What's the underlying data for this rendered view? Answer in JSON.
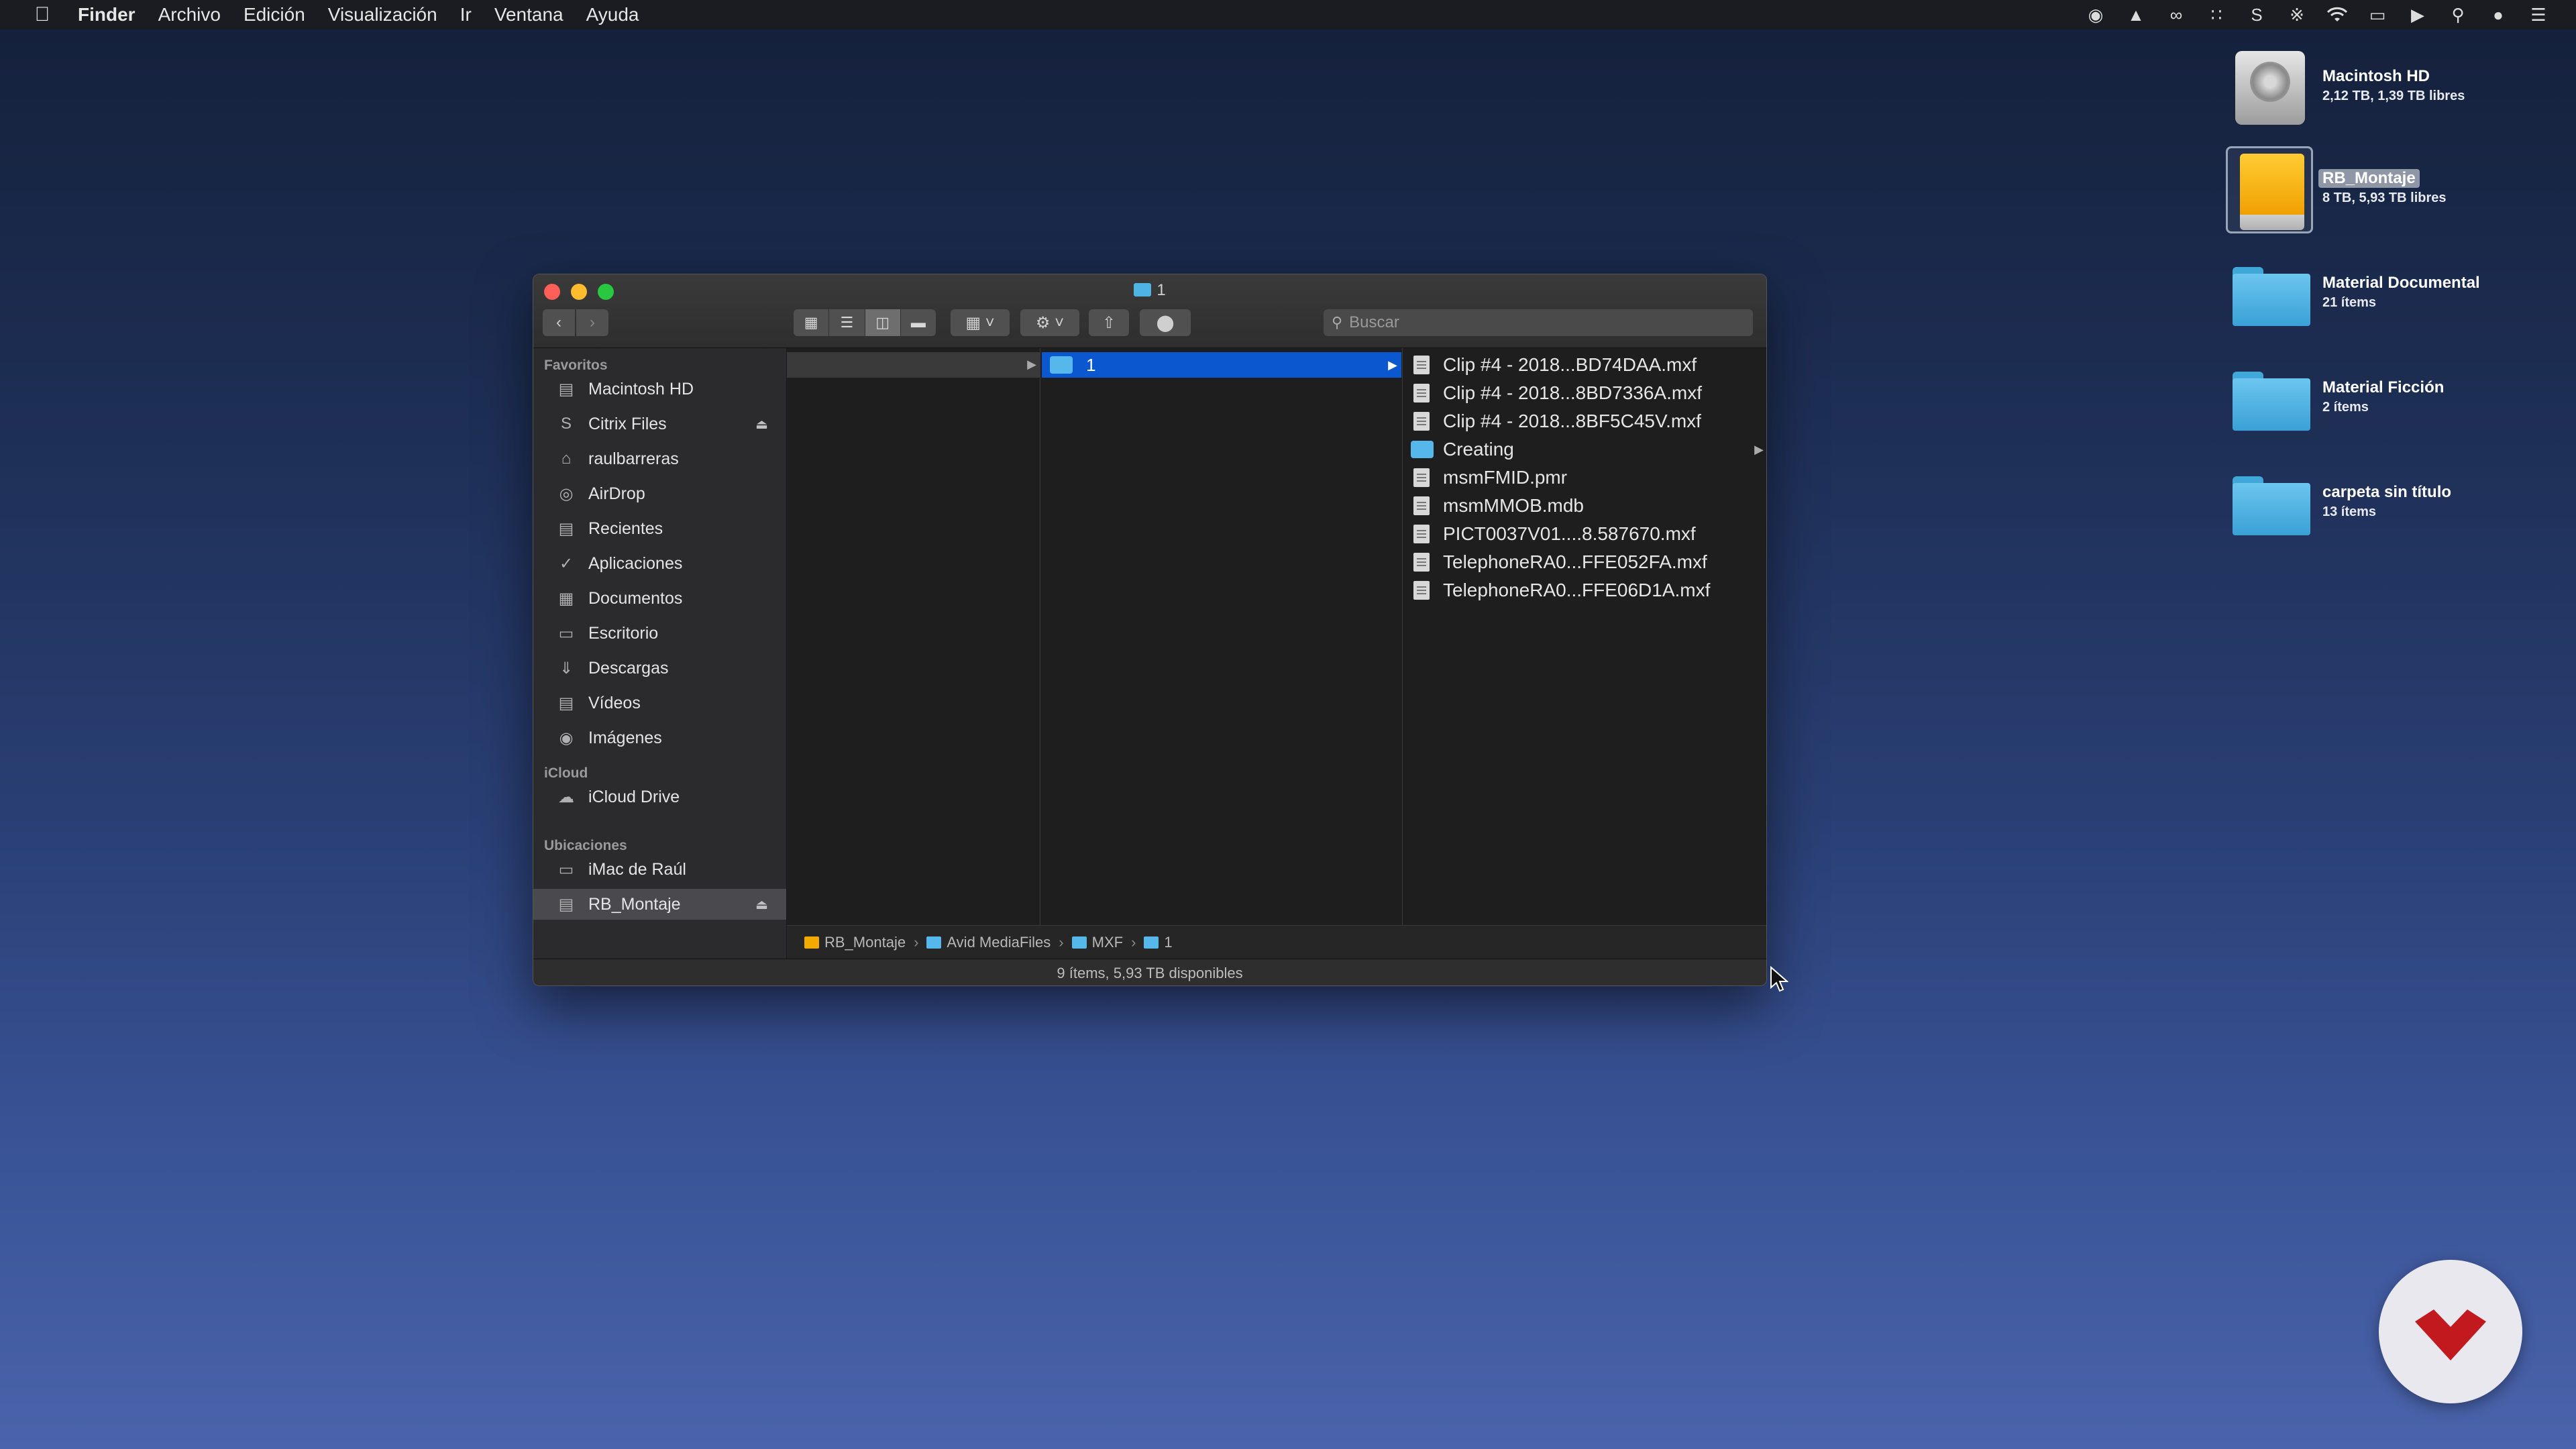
{
  "menubar": {
    "apple_icon": "apple-icon",
    "items": [
      "Finder",
      "Archivo",
      "Edición",
      "Visualización",
      "Ir",
      "Ventana",
      "Ayuda"
    ],
    "status_icons": [
      "record-icon",
      "upload-icon",
      "creative-cloud-icon",
      "grid-icon",
      "citrix-icon",
      "bluetooth-icon",
      "wifi-icon",
      "airplay-icon",
      "volume-icon",
      "spotlight-icon",
      "siri-icon",
      "notification-center-icon"
    ]
  },
  "desktop": {
    "items": [
      {
        "name": "Macintosh HD",
        "sub": "2,12 TB, 1,39 TB libres",
        "kind": "hd"
      },
      {
        "name": "RB_Montaje",
        "sub": "8 TB, 5,93 TB libres",
        "kind": "drive",
        "selected": true
      },
      {
        "name": "Material Documental",
        "sub": "21 ítems",
        "kind": "folder"
      },
      {
        "name": "Material Ficción",
        "sub": "2 ítems",
        "kind": "folder"
      },
      {
        "name": "carpeta sin título",
        "sub": "13 ítems",
        "kind": "folder"
      }
    ]
  },
  "window": {
    "title": "1",
    "search_placeholder": "Buscar",
    "sidebar": {
      "favoritos_header": "Favoritos",
      "favoritos": [
        {
          "label": "Macintosh HD",
          "icon": "hard-drive-icon"
        },
        {
          "label": "Citrix Files",
          "icon": "citrix-icon",
          "eject": true
        },
        {
          "label": "raulbarreras",
          "icon": "home-icon"
        },
        {
          "label": "AirDrop",
          "icon": "airdrop-icon"
        },
        {
          "label": "Recientes",
          "icon": "recents-icon"
        },
        {
          "label": "Aplicaciones",
          "icon": "applications-icon"
        },
        {
          "label": "Documentos",
          "icon": "documents-icon"
        },
        {
          "label": "Escritorio",
          "icon": "desktop-icon"
        },
        {
          "label": "Descargas",
          "icon": "downloads-icon"
        },
        {
          "label": "Vídeos",
          "icon": "movies-icon"
        },
        {
          "label": "Imágenes",
          "icon": "pictures-icon"
        }
      ],
      "icloud_header": "iCloud",
      "icloud": [
        {
          "label": "iCloud Drive",
          "icon": "cloud-icon"
        }
      ],
      "ubicaciones_header": "Ubicaciones",
      "ubicaciones": [
        {
          "label": "iMac de Raúl",
          "icon": "computer-icon"
        },
        {
          "label": "RB_Montaje",
          "icon": "external-drive-icon",
          "eject": true,
          "selected": true
        }
      ]
    },
    "column2_selected": "1",
    "files": [
      {
        "name": "Clip #4 - 2018...BD74DAA.mxf",
        "type": "file"
      },
      {
        "name": "Clip #4 - 2018...8BD7336A.mxf",
        "type": "file"
      },
      {
        "name": "Clip #4 - 2018...8BF5C45V.mxf",
        "type": "file"
      },
      {
        "name": "Creating",
        "type": "folder"
      },
      {
        "name": "msmFMID.pmr",
        "type": "file"
      },
      {
        "name": "msmMMOB.mdb",
        "type": "file"
      },
      {
        "name": "PICT0037V01....8.587670.mxf",
        "type": "file"
      },
      {
        "name": "TelephoneRA0...FFE052FA.mxf",
        "type": "file"
      },
      {
        "name": "TelephoneRA0...FFE06D1A.mxf",
        "type": "file"
      }
    ],
    "path": [
      "RB_Montaje",
      "Avid MediaFiles",
      "MXF",
      "1"
    ],
    "status": "9 ítems, 5,93 TB disponibles"
  },
  "colors": {
    "selection_blue": "#0b57d0",
    "folder_blue": "#56b8ea",
    "drive_orange": "#f2a900"
  }
}
